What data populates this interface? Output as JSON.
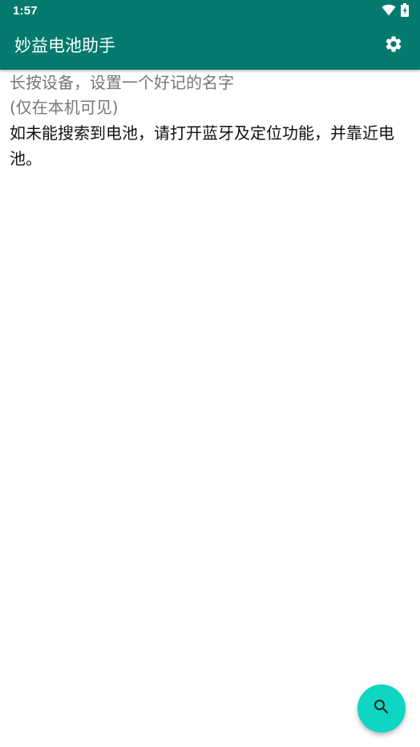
{
  "status_bar": {
    "time": "1:57",
    "icons": [
      "wifi-icon",
      "battery-icon"
    ]
  },
  "app_bar": {
    "title": "妙益电池助手",
    "settings_icon": "gear-icon",
    "color": "#047a6e"
  },
  "content": {
    "hint_line1": "长按设备，设置一个好记的名字",
    "hint_line2": "(仅在本机可见)",
    "tip": "如未能搜索到电池，请打开蓝牙及定位功能，并靠近电池。"
  },
  "fab": {
    "icon": "search-icon",
    "color": "#0fd6c3"
  }
}
